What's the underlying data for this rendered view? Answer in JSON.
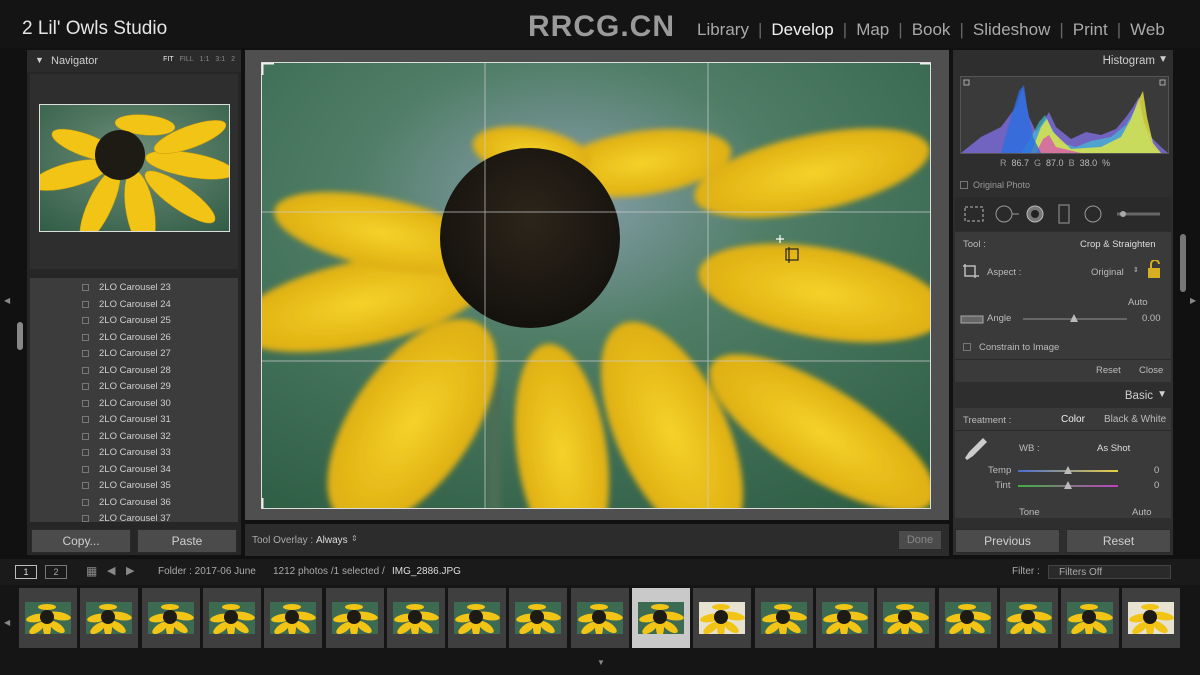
{
  "app": {
    "studio_name": "2 Lil' Owls Studio",
    "watermark": "RRCG.CN",
    "modules": [
      {
        "label": "Library",
        "active": false
      },
      {
        "label": "Develop",
        "active": true
      },
      {
        "label": "Map",
        "active": false
      },
      {
        "label": "Book",
        "active": false
      },
      {
        "label": "Slideshow",
        "active": false
      },
      {
        "label": "Print",
        "active": false
      },
      {
        "label": "Web",
        "active": false
      }
    ]
  },
  "navigator": {
    "title": "Navigator",
    "zoom_options": [
      "FIT",
      "FILL",
      "1:1",
      "3:1",
      "2"
    ],
    "selected_zoom": "FIT"
  },
  "collections": [
    "2LO Carousel 23",
    "2LO Carousel 24",
    "2LO Carousel 25",
    "2LO Carousel 26",
    "2LO Carousel 27",
    "2LO Carousel 28",
    "2LO Carousel 29",
    "2LO Carousel 30",
    "2LO Carousel 31",
    "2LO Carousel 32",
    "2LO Carousel 33",
    "2LO Carousel 34",
    "2LO Carousel 35",
    "2LO Carousel 36",
    "2LO Carousel 37"
  ],
  "left_buttons": {
    "copy": "Copy...",
    "paste": "Paste"
  },
  "toolbar": {
    "overlay_label": "Tool Overlay :",
    "overlay_value": "Always",
    "done": "Done"
  },
  "histogram": {
    "title": "Histogram",
    "r_label": "R",
    "r_value": "86.7",
    "g_label": "G",
    "g_value": "87.0",
    "b_label": "B",
    "b_value": "38.0",
    "percent": "%",
    "original_photo": "Original Photo"
  },
  "crop": {
    "tool_label": "Tool :",
    "tool_value": "Crop & Straighten",
    "aspect_label": "Aspect :",
    "aspect_value": "Original",
    "auto": "Auto",
    "angle_label": "Angle",
    "angle_value": "0.00",
    "constrain": "Constrain to Image",
    "reset": "Reset",
    "close": "Close"
  },
  "basic": {
    "title": "Basic",
    "treatment_label": "Treatment :",
    "color": "Color",
    "bw": "Black & White",
    "wb_label": "WB :",
    "wb_value": "As Shot",
    "temp_label": "Temp",
    "temp_value": "0",
    "tint_label": "Tint",
    "tint_value": "0",
    "tone_label": "Tone",
    "tone_auto": "Auto"
  },
  "right_buttons": {
    "previous": "Previous",
    "reset": "Reset"
  },
  "status": {
    "page1": "1",
    "page2": "2",
    "folder": "Folder : 2017-06 June",
    "count": "1212 photos /1 selected /",
    "filename": "IMG_2886.JPG",
    "filter_label": "Filter :",
    "filter_value": "Filters Off"
  },
  "filmstrip": {
    "thumbnail_count": 19,
    "selected_index": 10,
    "light_indices": [
      11,
      18
    ]
  },
  "colors": {
    "petal": "#f2c416",
    "center": "#1e1a14",
    "background": "#3d6b52",
    "accent": "#e6e6e6"
  }
}
